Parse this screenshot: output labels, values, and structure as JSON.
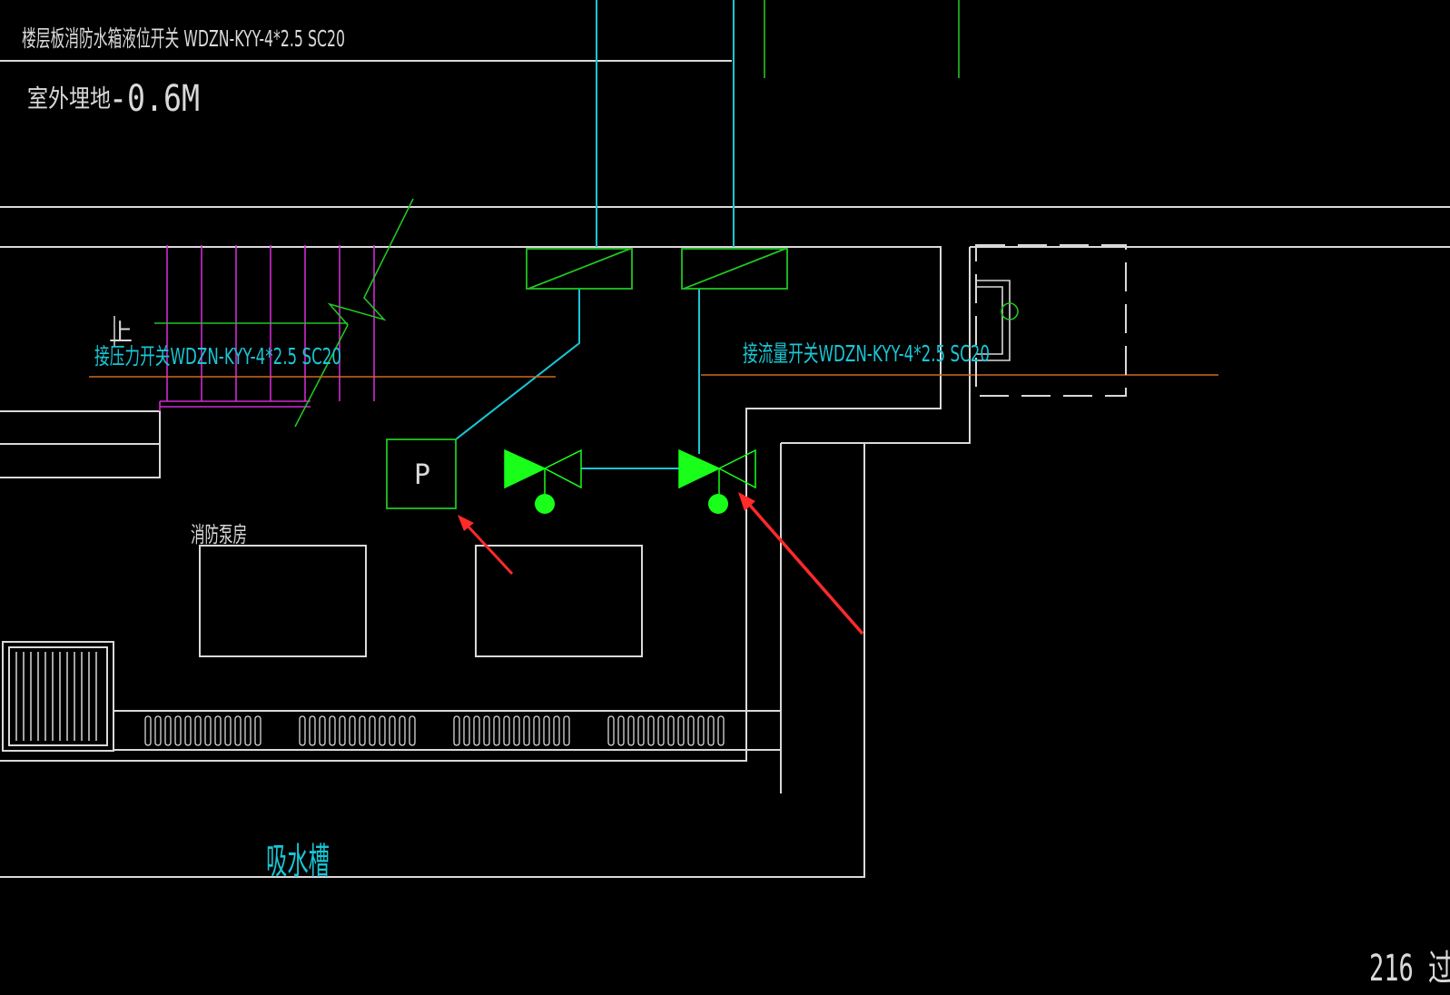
{
  "labels": {
    "top_cable": "楼层板消防水箱液位开关 WDZN-KYY-4*2.5 SC20",
    "outdoor_burial": "室外埋地",
    "outdoor_depth": "-0.6M",
    "stair_up": "上",
    "cable_left": "接压力开关WDZN-KYY-4*2.5 SC20",
    "cable_right": "接流量开关WDZN-KYY-4*2.5 SC20",
    "pressure_switch": "P",
    "pump_room": "消防泵房",
    "suction_tank": "吸水槽",
    "corner_text": "216 过"
  },
  "colors": {
    "background": "#000000",
    "wall": "#d9d9d9",
    "cable": "#19c6d6",
    "equipment": "#22c422",
    "valve_fill": "#19ff19",
    "stair": "#d12bd1",
    "orange_line": "#d2691e",
    "arrow": "#ff2a2a"
  }
}
